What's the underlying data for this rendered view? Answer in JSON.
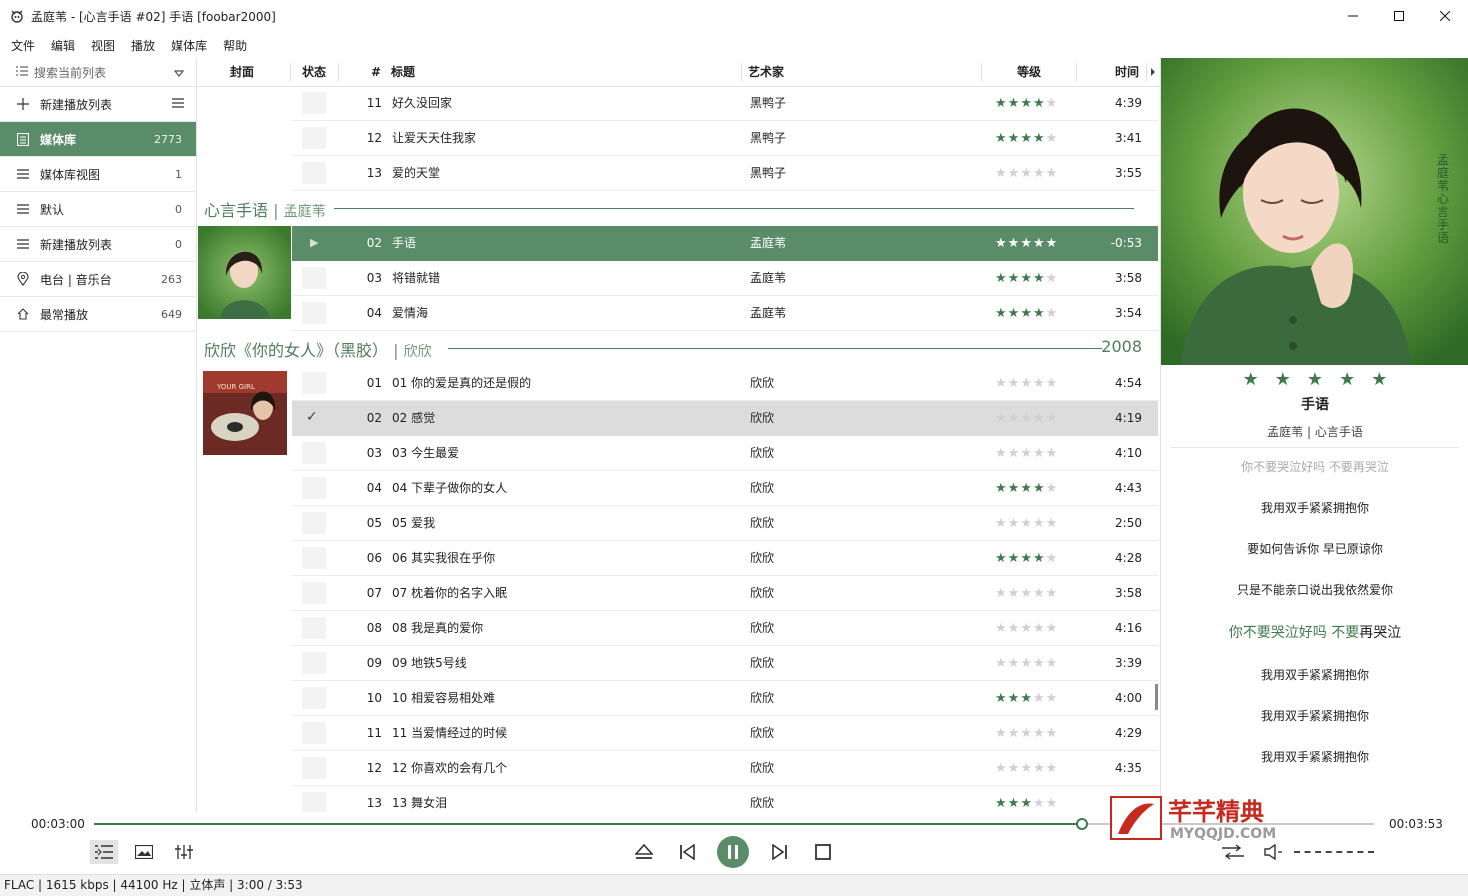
{
  "window": {
    "title": "孟庭苇 - [心言手语 #02] 手语  [foobar2000]",
    "controls": [
      "minimize",
      "maximize",
      "close"
    ]
  },
  "menu": [
    "文件",
    "编辑",
    "视图",
    "播放",
    "媒体库",
    "帮助"
  ],
  "sidebar": {
    "search_label": "搜索当前列表",
    "items": [
      {
        "label": "新建播放列表",
        "count": "",
        "icon": "plus-icon",
        "active": false
      },
      {
        "label": "媒体库",
        "count": "2773",
        "icon": "library-icon",
        "active": true
      },
      {
        "label": "媒体库视图",
        "count": "1",
        "icon": "list-icon",
        "active": false
      },
      {
        "label": "默认",
        "count": "0",
        "icon": "list-icon",
        "active": false
      },
      {
        "label": "新建播放列表",
        "count": "0",
        "icon": "list-icon",
        "active": false
      },
      {
        "label": "电台 | 音乐台",
        "count": "263",
        "icon": "location-icon",
        "active": false
      },
      {
        "label": "最常播放",
        "count": "649",
        "icon": "home-icon",
        "active": false
      }
    ]
  },
  "columns": {
    "cover": "封面",
    "status": "状态",
    "num": "#",
    "title": "标题",
    "artist": "艺术家",
    "rating": "等级",
    "time": "时间"
  },
  "groups": [
    {
      "title": "心言手语",
      "artist": "孟庭苇",
      "year": ""
    },
    {
      "title": "欣欣《你的女人》（黑胶）",
      "artist": "欣欣",
      "year": "2008"
    }
  ],
  "tracks_prev": [
    {
      "num": "11",
      "title": "好久没回家",
      "artist": "黑鸭子",
      "rating": 4,
      "time": "4:39"
    },
    {
      "num": "12",
      "title": "让爱天天住我家",
      "artist": "黑鸭子",
      "rating": 4,
      "time": "3:41"
    },
    {
      "num": "13",
      "title": "爱的天堂",
      "artist": "黑鸭子",
      "rating": 0,
      "time": "3:55"
    }
  ],
  "tracks_group1": [
    {
      "num": "02",
      "title": "手语",
      "artist": "孟庭苇",
      "rating": 5,
      "time": "-0:53",
      "playing": true
    },
    {
      "num": "03",
      "title": "将错就错",
      "artist": "孟庭苇",
      "rating": 4,
      "time": "3:58"
    },
    {
      "num": "04",
      "title": "爱情海",
      "artist": "孟庭苇",
      "rating": 4,
      "time": "3:54"
    }
  ],
  "tracks_group2": [
    {
      "num": "01",
      "title": "01 你的爱是真的还是假的",
      "artist": "欣欣",
      "rating": 0,
      "time": "4:54"
    },
    {
      "num": "02",
      "title": "02 感觉",
      "artist": "欣欣",
      "rating": 0,
      "time": "4:19",
      "checked": true
    },
    {
      "num": "03",
      "title": "03 今生最爱",
      "artist": "欣欣",
      "rating": 0,
      "time": "4:10"
    },
    {
      "num": "04",
      "title": "04 下辈子做你的女人",
      "artist": "欣欣",
      "rating": 4,
      "time": "4:43"
    },
    {
      "num": "05",
      "title": "05 爱我",
      "artist": "欣欣",
      "rating": 0,
      "time": "2:50"
    },
    {
      "num": "06",
      "title": "06 其实我很在乎你",
      "artist": "欣欣",
      "rating": 4,
      "time": "4:28"
    },
    {
      "num": "07",
      "title": "07 枕着你的名字入眠",
      "artist": "欣欣",
      "rating": 0,
      "time": "3:58"
    },
    {
      "num": "08",
      "title": "08 我是真的爱你",
      "artist": "欣欣",
      "rating": 0,
      "time": "4:16"
    },
    {
      "num": "09",
      "title": "09 地铁5号线",
      "artist": "欣欣",
      "rating": 0,
      "time": "3:39"
    },
    {
      "num": "10",
      "title": "10 相爱容易相处难",
      "artist": "欣欣",
      "rating": 3,
      "time": "4:00"
    },
    {
      "num": "11",
      "title": "11 当爱情经过的时候",
      "artist": "欣欣",
      "rating": 0,
      "time": "4:29"
    },
    {
      "num": "12",
      "title": "12 你喜欢的会有几个",
      "artist": "欣欣",
      "rating": 0,
      "time": "4:35"
    },
    {
      "num": "13",
      "title": "13 舞女泪",
      "artist": "欣欣",
      "rating": 3,
      "time": "4:26"
    }
  ],
  "now_playing": {
    "title": "手语",
    "meta": "孟庭苇 | 心言手语",
    "rating": 5,
    "cover_text": "孟庭苇 心言手语"
  },
  "lyrics": {
    "faded": "你不要哭泣好吗 不要再哭泣",
    "lines_before": [
      "我用双手紧紧拥抱你",
      "要如何告诉你 早已原谅你",
      "只是不能亲口说出我依然爱你"
    ],
    "current_green": "你不要哭泣好吗 不要",
    "current_rest": "再哭泣",
    "lines_after": [
      "我用双手紧紧拥抱你",
      "我用双手紧紧拥抱你",
      "我用双手紧紧拥抱你"
    ]
  },
  "playback": {
    "elapsed": "00:03:00",
    "total": "00:03:53",
    "progress": 0.772
  },
  "status": "FLAC | 1615 kbps | 44100 Hz | 立体声 | 3:00 / 3:53",
  "album_cover_text": "YOUR GIRL",
  "watermark": {
    "cn": "芊芊精典",
    "en": "MYQQJD.COM"
  },
  "colors": {
    "accent": "#5b8c69",
    "accent_dark": "#3f7a4f"
  }
}
